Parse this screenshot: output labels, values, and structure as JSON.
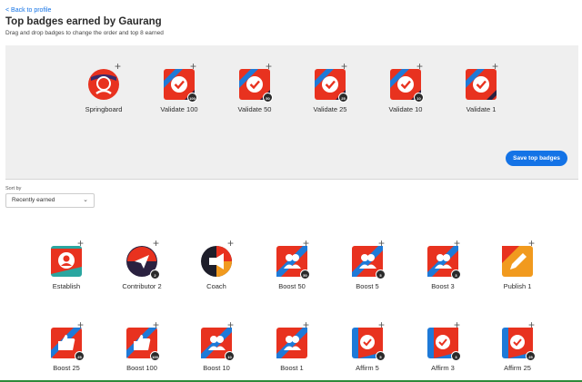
{
  "header": {
    "back_link": "< Back to profile",
    "title": "Top badges earned by Gaurang",
    "subtitle": "Drag and drop badges to change the order and top 8 earned"
  },
  "top_badges": [
    {
      "label": "Springboard",
      "icon": "springboard-hand-icon",
      "count": ""
    },
    {
      "label": "Validate 100",
      "icon": "validate-check-icon",
      "count": "100"
    },
    {
      "label": "Validate 50",
      "icon": "validate-check-icon",
      "count": "50"
    },
    {
      "label": "Validate 25",
      "icon": "validate-check-icon",
      "count": "25"
    },
    {
      "label": "Validate 10",
      "icon": "validate-check-icon",
      "count": "10"
    },
    {
      "label": "Validate 1",
      "icon": "validate-check-icon",
      "count": ""
    }
  ],
  "save_button": "Save top badges",
  "sort": {
    "label": "Sort by",
    "selected": "Recently earned"
  },
  "earned_badges_row1": [
    {
      "label": "Establish",
      "icon": "establish-person-icon",
      "count": ""
    },
    {
      "label": "Contributor 2",
      "icon": "contributor-plane-icon",
      "count": "2"
    },
    {
      "label": "Coach",
      "icon": "coach-megaphone-icon",
      "count": ""
    },
    {
      "label": "Boost 50",
      "icon": "boost-people-icon",
      "count": "50"
    },
    {
      "label": "Boost 5",
      "icon": "boost-people-icon",
      "count": "5"
    },
    {
      "label": "Boost 3",
      "icon": "boost-people-icon",
      "count": "3"
    },
    {
      "label": "Publish 1",
      "icon": "publish-pencil-icon",
      "count": ""
    }
  ],
  "earned_badges_row2": [
    {
      "label": "Boost 25",
      "icon": "boost-thumbs-icon",
      "count": "25"
    },
    {
      "label": "Boost 100",
      "icon": "boost-thumbs-icon",
      "count": "100"
    },
    {
      "label": "Boost 10",
      "icon": "boost-people-icon",
      "count": "10"
    },
    {
      "label": "Boost 1",
      "icon": "boost-people-icon",
      "count": ""
    },
    {
      "label": "Affirm 5",
      "icon": "affirm-check-icon",
      "count": "5"
    },
    {
      "label": "Affirm 3",
      "icon": "affirm-check-icon",
      "count": "3"
    },
    {
      "label": "Affirm 25",
      "icon": "affirm-check-icon",
      "count": "25"
    }
  ],
  "colors": {
    "accent": "#1473e6",
    "badge_red": "#e8321f",
    "panel_bg": "#efefef"
  }
}
